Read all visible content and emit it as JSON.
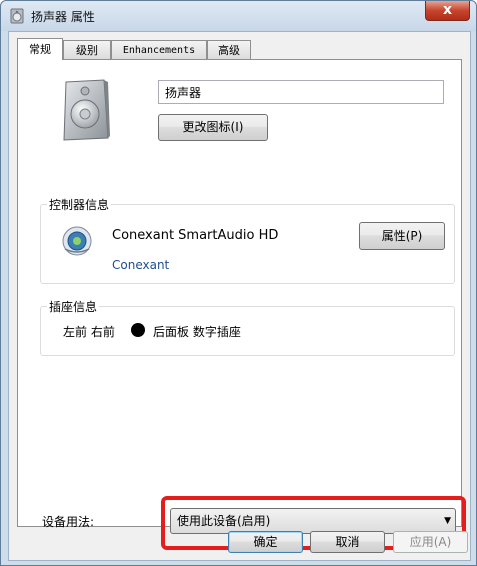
{
  "window": {
    "title": "扬声器 属性",
    "close_glyph": "x"
  },
  "tabs": [
    {
      "label": "常规",
      "active": true
    },
    {
      "label": "级别",
      "active": false
    },
    {
      "label": "Enhancements",
      "active": false
    },
    {
      "label": "高级",
      "active": false
    }
  ],
  "general": {
    "device_name": "扬声器",
    "change_icon_label": "更改图标(I)"
  },
  "controller": {
    "group_title": "控制器信息",
    "name": "Conexant SmartAudio HD",
    "vendor": "Conexant",
    "properties_label": "属性(P)"
  },
  "jack": {
    "group_title": "插座信息",
    "location": "左前 右前",
    "description": "后面板 数字插座",
    "color": "#000000"
  },
  "usage": {
    "label": "设备用法:",
    "selected": "使用此设备(启用)"
  },
  "footer": {
    "ok_label": "确定",
    "cancel_label": "取消",
    "apply_label": "应用(A)"
  },
  "colors": {
    "highlight": "#e41d1d",
    "vendor_link": "#1f4f8f"
  }
}
